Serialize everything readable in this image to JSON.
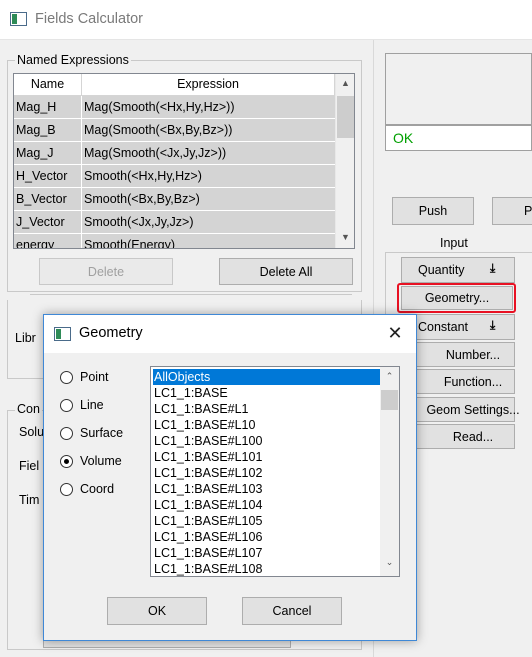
{
  "main_window": {
    "title": "Fields Calculator",
    "named_expressions": {
      "group_label": "Named Expressions",
      "columns": [
        "Name",
        "Expression"
      ],
      "rows": [
        {
          "name": "Mag_H",
          "expression": "Mag(Smooth(<Hx,Hy,Hz>))"
        },
        {
          "name": "Mag_B",
          "expression": "Mag(Smooth(<Bx,By,Bz>))"
        },
        {
          "name": "Mag_J",
          "expression": "Mag(Smooth(<Jx,Jy,Jz>))"
        },
        {
          "name": "H_Vector",
          "expression": "Smooth(<Hx,Hy,Hz>)"
        },
        {
          "name": "B_Vector",
          "expression": "Smooth(<Bx,By,Bz>)"
        },
        {
          "name": "J_Vector",
          "expression": "Smooth(<Jx,Jy,Jz>)"
        },
        {
          "name": "energy",
          "expression": "Smooth(Energy)"
        }
      ],
      "delete_label": "Delete",
      "delete_all_label": "Delete All"
    },
    "partial_labels": {
      "libr": "Libr",
      "con": "Con",
      "solu": "Solu",
      "field": "Fiel",
      "time": "Tim"
    },
    "status_text": "OK",
    "push_label": "Push",
    "pop_partial": "P",
    "input_label": "Input",
    "input_buttons": {
      "quantity": "Quantity",
      "geometry": "Geometry...",
      "constant": "Constant",
      "number": "Number...",
      "function": "Function...",
      "geom_settings": "Geom Settings...",
      "read": "Read..."
    },
    "highlight_color": "#e81123",
    "status_color": "#00a000"
  },
  "geometry_dialog": {
    "title": "Geometry",
    "close_glyph": "✕",
    "radio_options": [
      "Point",
      "Line",
      "Surface",
      "Volume",
      "Coord"
    ],
    "selected_option": "Volume",
    "list_items": [
      "AllObjects",
      "LC1_1:BASE",
      "LC1_1:BASE#L1",
      "LC1_1:BASE#L10",
      "LC1_1:BASE#L100",
      "LC1_1:BASE#L101",
      "LC1_1:BASE#L102",
      "LC1_1:BASE#L103",
      "LC1_1:BASE#L104",
      "LC1_1:BASE#L105",
      "LC1_1:BASE#L106",
      "LC1_1:BASE#L107",
      "LC1_1:BASE#L108"
    ],
    "selected_item": "AllObjects",
    "ok_label": "OK",
    "cancel_label": "Cancel",
    "selection_color": "#0078d7"
  }
}
